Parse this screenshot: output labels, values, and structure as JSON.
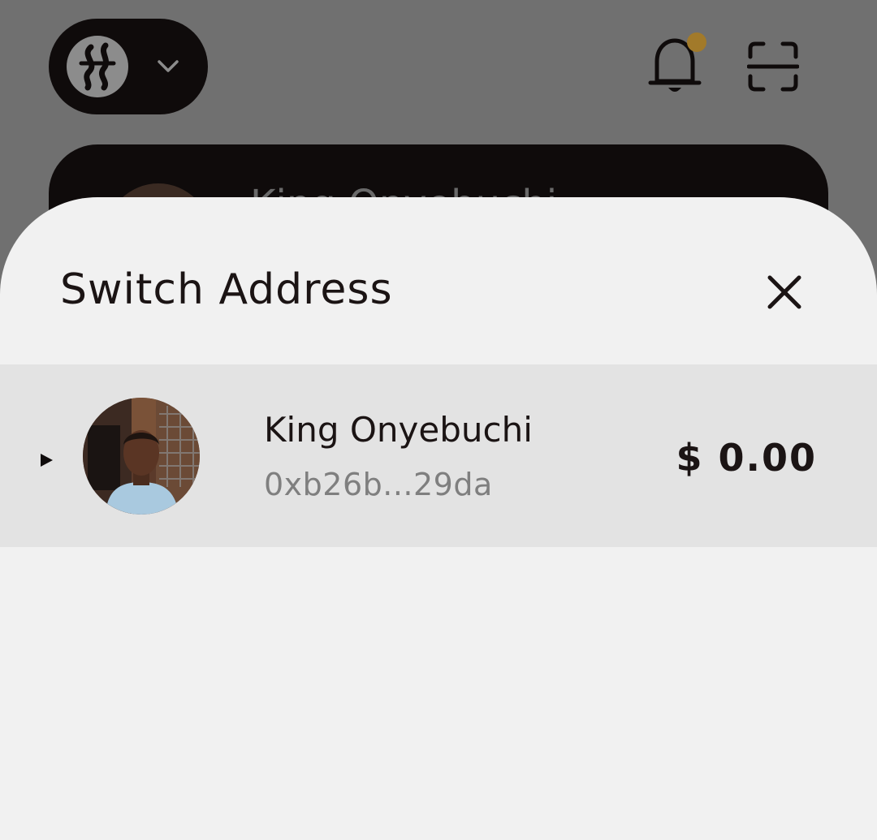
{
  "background": {
    "header": {
      "chain_icon": "chain-logo-icon",
      "dropdown_icon": "chevron-down-icon",
      "notifications_icon": "bell-icon",
      "scan_icon": "scan-icon",
      "notification_dot_color": "#a27a2a"
    },
    "account_card": {
      "name_partial": "King Onyebuchi"
    }
  },
  "sheet": {
    "title": "Switch Address",
    "close_icon": "close-icon",
    "addresses": [
      {
        "name": "King Onyebuchi",
        "address": "0xb26b...29da",
        "balance": "$ 0.00",
        "selected": true,
        "marker_icon": "play-triangle-icon"
      }
    ]
  },
  "colors": {
    "overlay": "#707070",
    "sheet_background": "#f1f1f1",
    "selected_row": "#e3e3e3",
    "text_primary": "#1b1414",
    "text_secondary": "#7f7f7f"
  }
}
